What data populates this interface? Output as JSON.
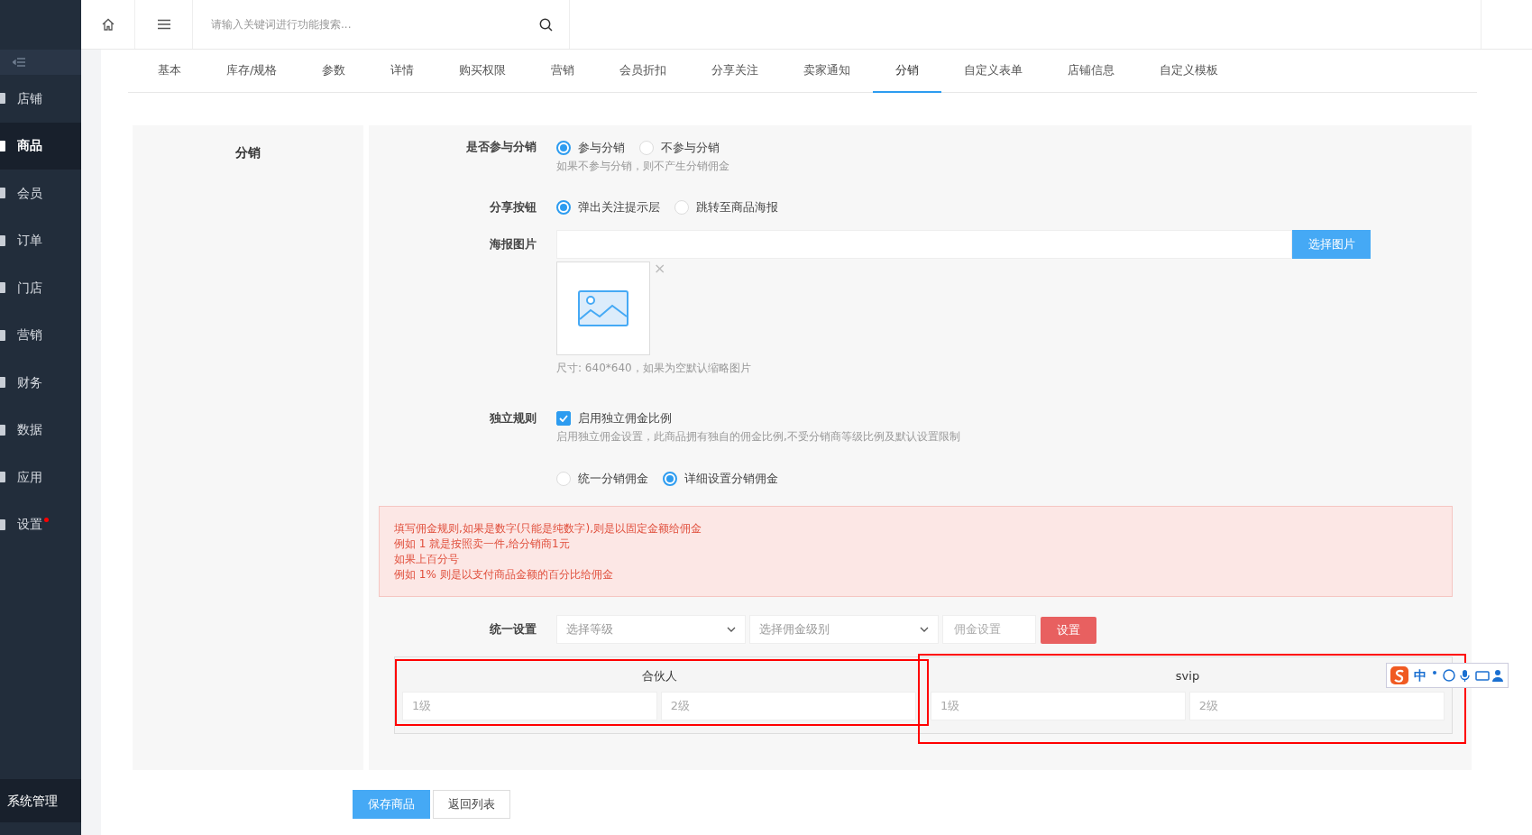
{
  "topbar": {
    "search": {
      "placeholder": "请输入关键词进行功能搜索..."
    }
  },
  "sidebar": {
    "items": [
      {
        "label": "店铺",
        "selected": false,
        "dot": false
      },
      {
        "label": "商品",
        "selected": true,
        "dot": false
      },
      {
        "label": "会员",
        "selected": false,
        "dot": false
      },
      {
        "label": "订单",
        "selected": false,
        "dot": false
      },
      {
        "label": "门店",
        "selected": false,
        "dot": false
      },
      {
        "label": "营销",
        "selected": false,
        "dot": false
      },
      {
        "label": "财务",
        "selected": false,
        "dot": false
      },
      {
        "label": "数据",
        "selected": false,
        "dot": false
      },
      {
        "label": "应用",
        "selected": false,
        "dot": false
      },
      {
        "label": "设置",
        "selected": false,
        "dot": true
      }
    ],
    "footer": "系统管理"
  },
  "tabs": [
    {
      "label": "基本",
      "selected": false
    },
    {
      "label": "库存/规格",
      "selected": false
    },
    {
      "label": "参数",
      "selected": false
    },
    {
      "label": "详情",
      "selected": false
    },
    {
      "label": "购买权限",
      "selected": false
    },
    {
      "label": "营销",
      "selected": false
    },
    {
      "label": "会员折扣",
      "selected": false
    },
    {
      "label": "分享关注",
      "selected": false
    },
    {
      "label": "卖家通知",
      "selected": false
    },
    {
      "label": "分销",
      "selected": true
    },
    {
      "label": "自定义表单",
      "selected": false
    },
    {
      "label": "店铺信息",
      "selected": false
    },
    {
      "label": "自定义模板",
      "selected": false
    }
  ],
  "section": {
    "title": "分销",
    "participate": {
      "label": "是否参与分销",
      "options": [
        {
          "label": "参与分销",
          "selected": true
        },
        {
          "label": "不参与分销",
          "selected": false
        }
      ],
      "hint": "如果不参与分销，则不产生分销佣金"
    },
    "share_button": {
      "label": "分享按钮",
      "options": [
        {
          "label": "弹出关注提示层",
          "selected": true
        },
        {
          "label": "跳转至商品海报",
          "selected": false
        }
      ]
    },
    "poster": {
      "label": "海报图片",
      "button": "选择图片",
      "remove": "×",
      "hint": "尺寸: 640*640，如果为空默认缩略图片"
    },
    "independent": {
      "label": "独立规则",
      "checkbox": {
        "label": "启用独立佣金比例",
        "checked": true
      },
      "hint": "启用独立佣金设置，此商品拥有独自的佣金比例,不受分销商等级比例及默认设置限制"
    },
    "commission_mode": {
      "options": [
        {
          "label": "统一分销佣金",
          "selected": false
        },
        {
          "label": "详细设置分销佣金",
          "selected": true
        }
      ]
    },
    "alert": [
      "填写佣金规则,如果是数字(只能是纯数字),则是以固定金额给佣金",
      "例如 1 就是按照卖一件,给分销商1元",
      "如果上百分号",
      "例如 1% 则是以支付商品金额的百分比给佣金"
    ],
    "unified": {
      "label": "统一设置",
      "level_select": {
        "placeholder": "选择等级"
      },
      "tier_select": {
        "placeholder": "选择佣金级别"
      },
      "amount": {
        "placeholder": "佣金设置"
      },
      "button": "设置"
    },
    "groups": [
      {
        "name": "合伙人",
        "highlighted": true,
        "inputs": [
          {
            "placeholder": "1级"
          },
          {
            "placeholder": "2级"
          }
        ]
      },
      {
        "name": "svip",
        "highlighted": true,
        "inputs": [
          {
            "placeholder": "1级"
          },
          {
            "placeholder": "2级"
          }
        ]
      }
    ]
  },
  "actions": [
    {
      "label": "保存商品",
      "kind": "primary"
    },
    {
      "label": "返回列表",
      "kind": "default"
    }
  ],
  "ime_toolbar": {
    "label": "中"
  }
}
